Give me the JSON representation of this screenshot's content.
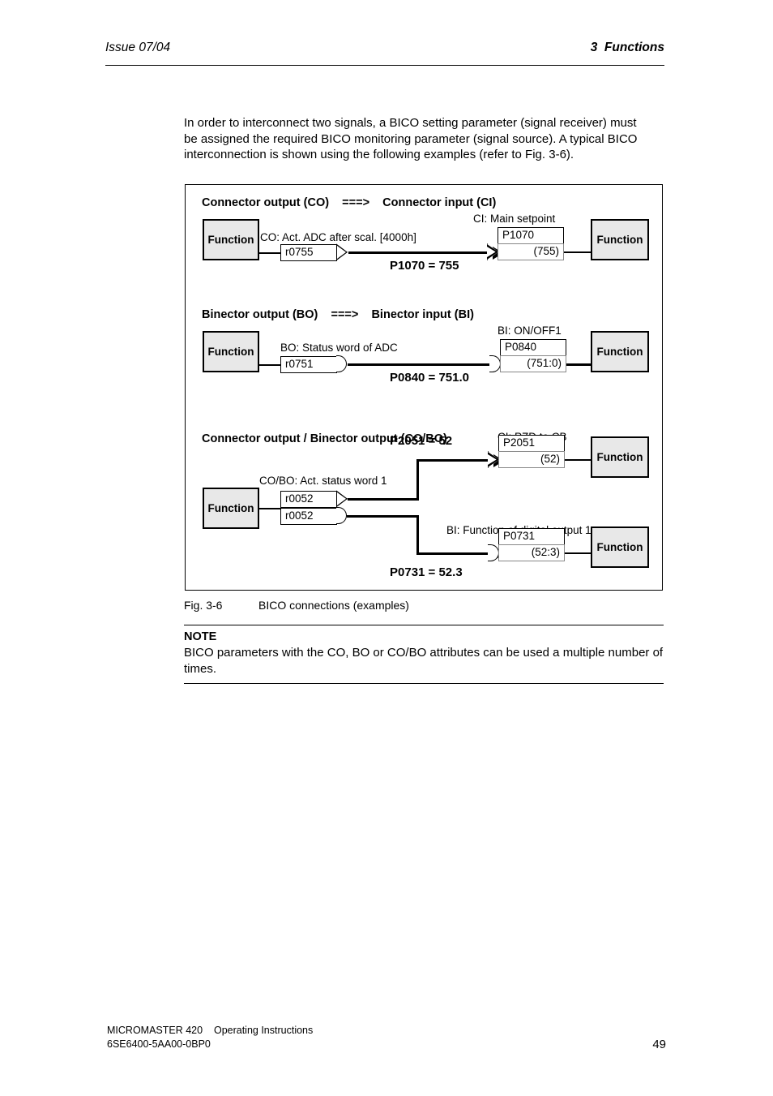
{
  "header": {
    "issue": "Issue 07/04",
    "section": "3  Functions"
  },
  "intro": {
    "paragraph": "In order to interconnect two signals, a BICO setting parameter (signal receiver) must be assigned the required BICO monitoring parameter (signal source). A typical BICO interconnection is shown using the following examples (refer to Fig. 3-6)."
  },
  "figure": {
    "caption_number": "Fig. 3-6",
    "caption_text": "BICO connections (examples)",
    "function_label": "Function",
    "blocks": [
      {
        "title": "Connector output (CO)    ===>    Connector input (CI)",
        "source_desc": "CO: Act. ADC after scal. [4000h]",
        "source_tag": "r0755",
        "target_desc": "CI: Main setpoint",
        "target_param": "P1070",
        "target_value": "(755)",
        "assignment": "P1070 = 755"
      },
      {
        "title": "Binector output (BO)    ===>    Binector input (BI)",
        "source_desc": "BO: Status word of ADC",
        "source_tag": "r0751",
        "target_desc": "BI: ON/OFF1",
        "target_param": "P0840",
        "target_value": "(751:0)",
        "assignment": "P0840 = 751.0"
      },
      {
        "title": "Connector output / Binector output (CO/BO)",
        "source_desc": "CO/BO: Act. status word 1",
        "source_tag_co": "r0052",
        "source_tag_bo": "r0052",
        "target_desc_1": "CI: PZD to CB",
        "target_param_1": "P2051",
        "target_value_1": "(52)",
        "assignment_1": "P2051 = 52",
        "target_desc_2": "BI: Function of digital output 1",
        "target_param_2": "P0731",
        "target_value_2": "(52:3)",
        "assignment_2": "P0731 = 52.3"
      }
    ]
  },
  "note": {
    "title": "NOTE",
    "body": "BICO parameters with the CO, BO or CO/BO attributes can be used a multiple number of times."
  },
  "footer": {
    "line1": "MICROMASTER 420    Operating Instructions",
    "line2": "6SE6400-5AA00-0BP0",
    "page_number": "49"
  }
}
